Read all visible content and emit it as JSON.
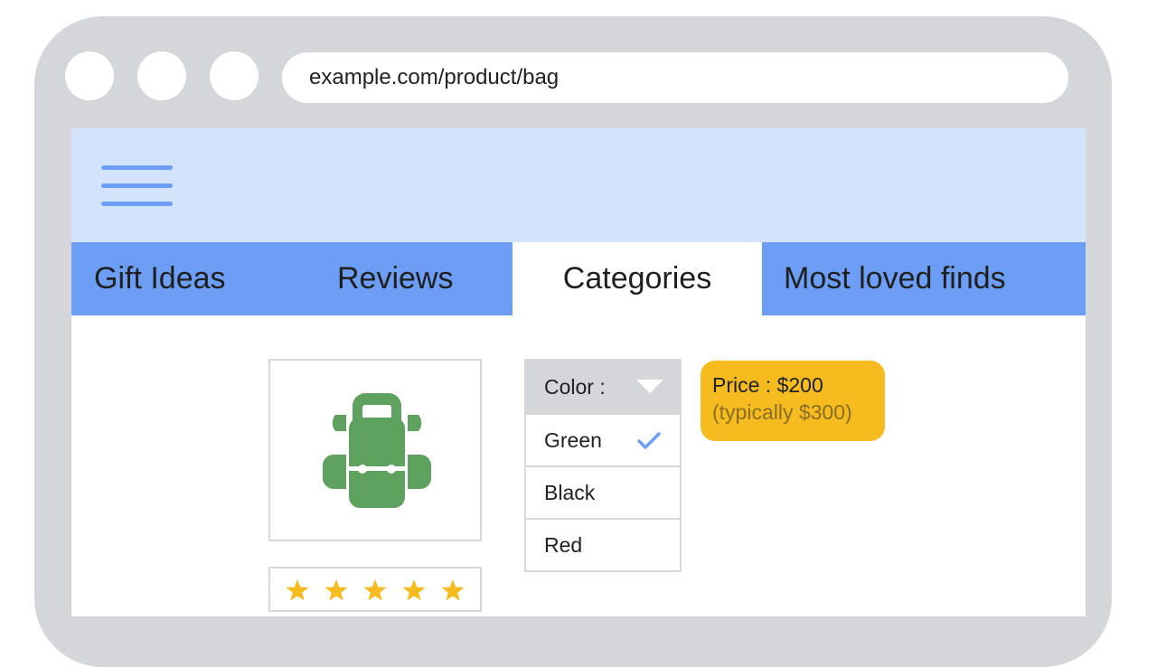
{
  "browser": {
    "url": "example.com/product/bag"
  },
  "header": {
    "menu_icon": "hamburger-menu-icon"
  },
  "nav": {
    "tabs": [
      {
        "label": "Gift Ideas",
        "active": false
      },
      {
        "label": "Reviews",
        "active": false
      },
      {
        "label": "Categories",
        "active": true
      },
      {
        "label": "Most loved finds",
        "active": false
      }
    ]
  },
  "product": {
    "image_icon": "backpack-icon",
    "rating": {
      "stars": 5,
      "max": 5,
      "icon": "star-icon"
    }
  },
  "color_select": {
    "label": "Color :",
    "options": [
      {
        "label": "Green",
        "selected": true
      },
      {
        "label": "Black",
        "selected": false
      },
      {
        "label": "Red",
        "selected": false
      }
    ]
  },
  "price": {
    "current": "Price : $200",
    "typical": "(typically $300)"
  },
  "colors": {
    "frame": "#d4d6d9",
    "header_bg": "#d3e3fb",
    "nav_bg": "#6c9ef5",
    "accent": "#6c9ef5",
    "backpack": "#5fa15e",
    "star": "#f5bb1f",
    "price_badge": "#f5bb1f"
  }
}
